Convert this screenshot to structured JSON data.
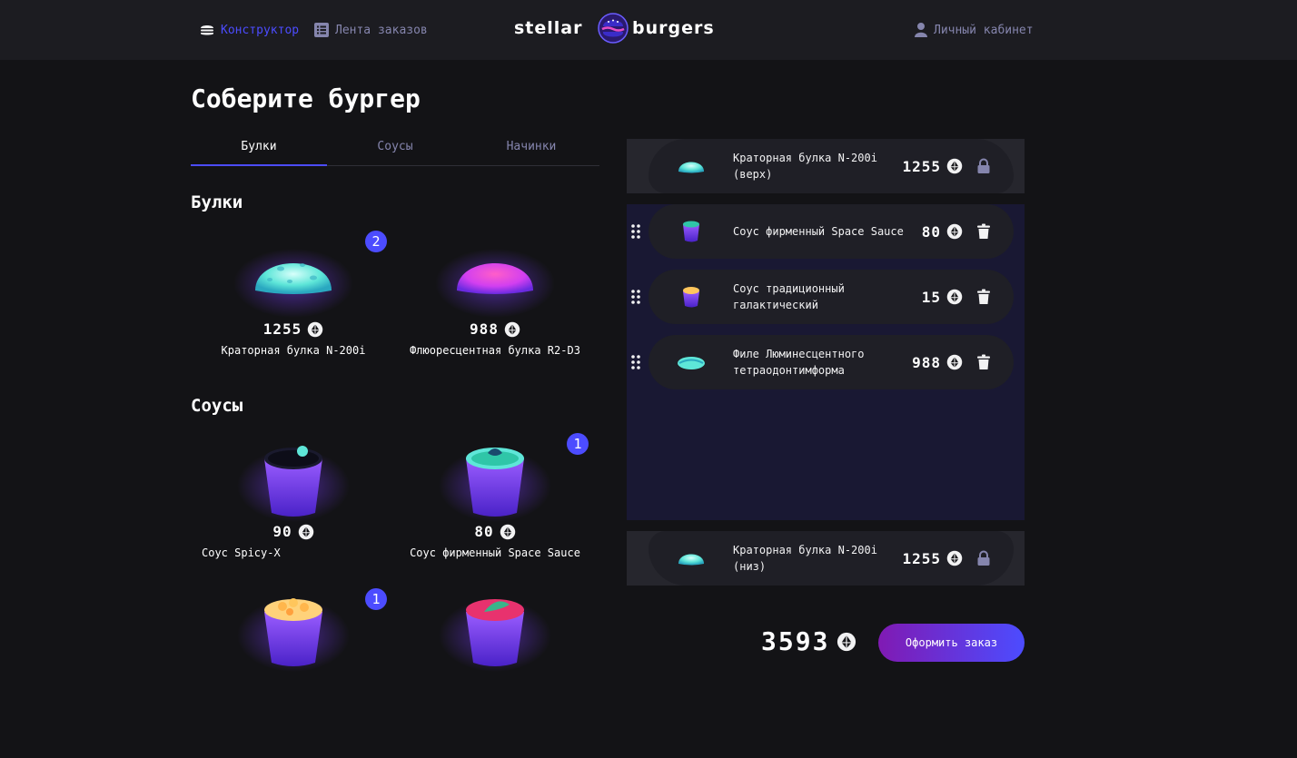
{
  "header": {
    "nav": [
      {
        "label": "Конструктор",
        "icon": "burger-icon",
        "active": true
      },
      {
        "label": "Лента заказов",
        "icon": "list-icon",
        "active": false
      }
    ],
    "logo_left": "stellar",
    "logo_right": "burgers",
    "profile_label": "Личный кабинет"
  },
  "page_title": "Соберите бургер",
  "tabs": [
    {
      "label": "Булки",
      "active": true
    },
    {
      "label": "Соусы",
      "active": false
    },
    {
      "label": "Начинки",
      "active": false
    }
  ],
  "sections": {
    "buns_title": "Булки",
    "sauces_title": "Соусы"
  },
  "ingredients": [
    {
      "name": "Краторная булка N-200i",
      "price": "1255",
      "count": "2",
      "kind": "bun-cyan"
    },
    {
      "name": "Флюоресцентная булка R2-D3",
      "price": "988",
      "count": null,
      "kind": "bun-pink"
    },
    {
      "name": "Соус Spicy-X",
      "price": "90",
      "count": null,
      "kind": "sauce-dark"
    },
    {
      "name": "Соус фирменный Space Sauce",
      "price": "80",
      "count": "1",
      "kind": "sauce-green"
    },
    {
      "name": "",
      "price": "",
      "count": "1",
      "kind": "sauce-orange"
    },
    {
      "name": "",
      "price": "",
      "count": null,
      "kind": "sauce-pink"
    }
  ],
  "constructor": {
    "top_bun": {
      "name": "Краторная булка N-200i (верх)",
      "price": "1255",
      "action_icon": "lock-icon"
    },
    "fillings": [
      {
        "name": "Соус фирменный Space Sauce",
        "price": "80",
        "action_icon": "trash-icon"
      },
      {
        "name": "Соус традиционный галактический",
        "price": "15",
        "action_icon": "trash-icon"
      },
      {
        "name": "Филе Люминесцентного тетраодонтимформа",
        "price": "988",
        "action_icon": "trash-icon"
      }
    ],
    "bottom_bun": {
      "name": "Краторная булка N-200i (низ)",
      "price": "1255",
      "action_icon": "lock-icon"
    }
  },
  "total": "3593",
  "order_button": "Оформить заказ",
  "colors": {
    "accent": "#4c4cff",
    "background": "#131316",
    "header": "#1c1c21",
    "muted": "#8585ad"
  }
}
